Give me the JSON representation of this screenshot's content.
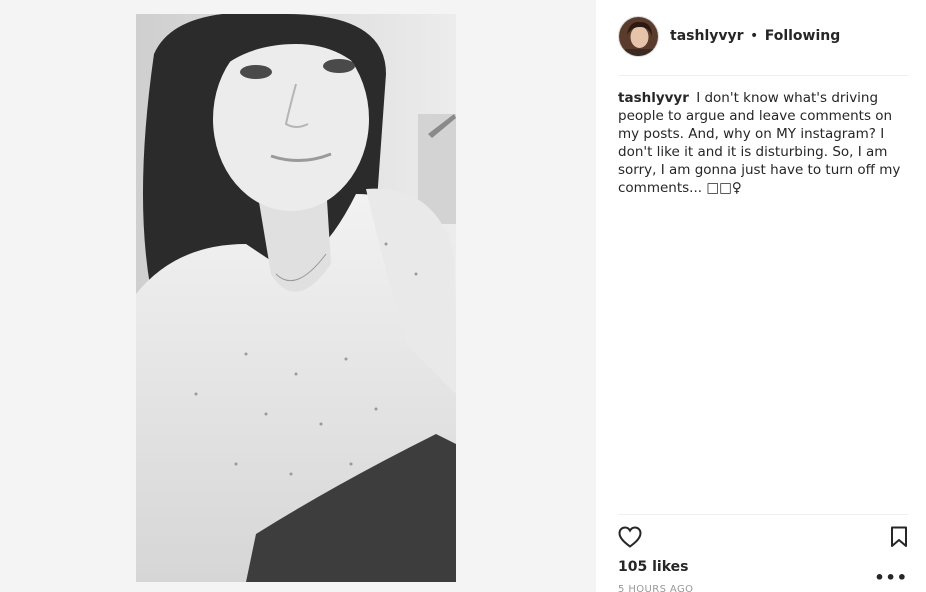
{
  "post": {
    "username": "tashlyvyr",
    "separator": "•",
    "follow_status": "Following",
    "caption_user": "tashlyvyr",
    "caption_text": "I don't know what's driving people to argue and leave comments on my posts. And, why on MY instagram? I don't like it and it is disturbing. So, I am sorry, I am gonna just have to turn off my comments... □□♀",
    "likes": "105 likes",
    "timestamp": "5 HOURS AGO",
    "more_label": "•••"
  },
  "icons": {
    "like": "heart-icon",
    "save": "bookmark-icon",
    "more": "more-options-icon"
  },
  "colors": {
    "text": "#262626",
    "muted": "#999999",
    "divider": "#efefef",
    "media_background": "#f4f4f4"
  }
}
